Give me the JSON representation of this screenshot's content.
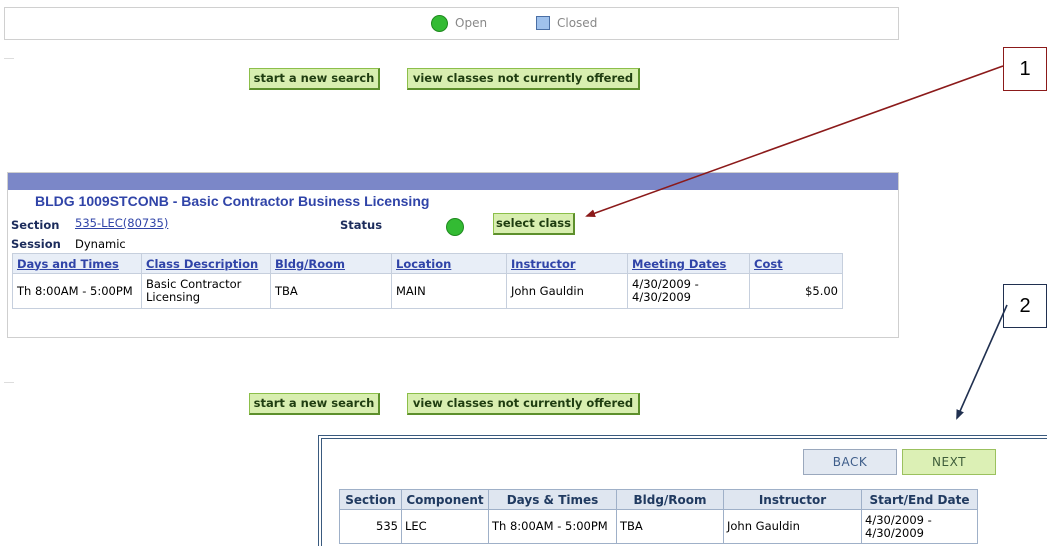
{
  "legend": {
    "open_label": "Open",
    "closed_label": "Closed",
    "open_color": "#33bb33",
    "closed_color": "#9fc1ec"
  },
  "buttons": {
    "new_search": "start a new search",
    "not_offered": "view classes not currently offered",
    "select_class": "select class"
  },
  "class": {
    "title": "BLDG 1009STCONB - Basic Contractor Business Licensing",
    "section_label": "Section",
    "section_value": "535-LEC(80735)",
    "status_label": "Status",
    "session_label": "Session",
    "session_value": "Dynamic",
    "headers": [
      "Days and Times",
      "Class Description",
      "Bldg/Room",
      "Location",
      "Instructor",
      "Meeting Dates",
      "Cost"
    ],
    "row": [
      "Th 8:00AM - 5:00PM",
      "Basic Contractor Licensing",
      "TBA",
      "MAIN",
      "John Gauldin",
      "4/30/2009 - 4/30/2009",
      "$5.00"
    ]
  },
  "callouts": [
    "1",
    "2"
  ],
  "enrollment": {
    "back_label": "BACK",
    "next_label": "NEXT",
    "headers": [
      "Section",
      "Component",
      "Days & Times",
      "Bldg/Room",
      "Instructor",
      "Start/End Date"
    ],
    "row": [
      "535",
      "LEC",
      "Th 8:00AM - 5:00PM",
      "TBA",
      "John Gauldin",
      "4/30/2009 - 4/30/2009"
    ]
  }
}
